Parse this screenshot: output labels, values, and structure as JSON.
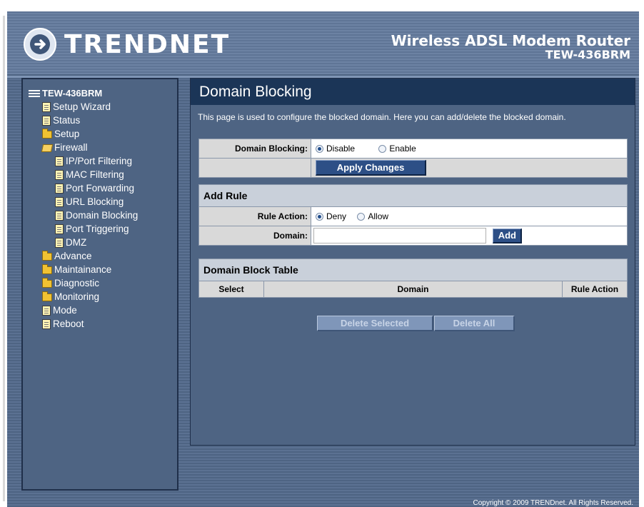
{
  "header": {
    "brand": "TRENDNET",
    "product_line1": "Wireless ADSL Modem Router",
    "product_line2": "TEW-436BRM"
  },
  "sidebar": {
    "root": "TEW-436BRM",
    "items": [
      {
        "label": "Setup Wizard",
        "icon": "document-icon"
      },
      {
        "label": "Status",
        "icon": "document-icon"
      },
      {
        "label": "Setup",
        "icon": "folder-icon"
      },
      {
        "label": "Firewall",
        "icon": "folder-open-icon"
      },
      {
        "label": "IP/Port Filtering",
        "icon": "document-icon"
      },
      {
        "label": "MAC Filtering",
        "icon": "document-icon"
      },
      {
        "label": "Port Forwarding",
        "icon": "document-icon"
      },
      {
        "label": "URL Blocking",
        "icon": "document-icon"
      },
      {
        "label": "Domain Blocking",
        "icon": "document-icon"
      },
      {
        "label": "Port Triggering",
        "icon": "document-icon"
      },
      {
        "label": "DMZ",
        "icon": "document-icon"
      },
      {
        "label": "Advance",
        "icon": "folder-icon"
      },
      {
        "label": "Maintainance",
        "icon": "folder-icon"
      },
      {
        "label": "Diagnostic",
        "icon": "folder-icon"
      },
      {
        "label": "Monitoring",
        "icon": "folder-icon"
      },
      {
        "label": "Mode",
        "icon": "document-icon"
      },
      {
        "label": "Reboot",
        "icon": "document-icon"
      }
    ]
  },
  "main": {
    "title": "Domain Blocking",
    "description": "This page is used to configure the blocked domain. Here you can add/delete the blocked domain.",
    "domain_blocking": {
      "label": "Domain Blocking:",
      "options": [
        "Disable",
        "Enable"
      ],
      "selected": "Disable"
    },
    "apply_label": "Apply Changes",
    "add_rule": {
      "header": "Add Rule",
      "rule_action_label": "Rule Action:",
      "rule_options": [
        "Deny",
        "Allow"
      ],
      "rule_selected": "Deny",
      "domain_label": "Domain:",
      "domain_value": "",
      "add_label": "Add"
    },
    "table": {
      "header": "Domain Block Table",
      "columns": [
        "Select",
        "Domain",
        "Rule Action"
      ],
      "rows": []
    },
    "delete_selected_label": "Delete Selected",
    "delete_all_label": "Delete All"
  },
  "footer": {
    "copyright": "Copyright © 2009 TRENDnet. All Rights Reserved."
  },
  "colors": {
    "header_bg": "#5f7596",
    "panel_bg": "#4e6483",
    "title_bar": "#1b3557",
    "button": "#2d4f86"
  }
}
